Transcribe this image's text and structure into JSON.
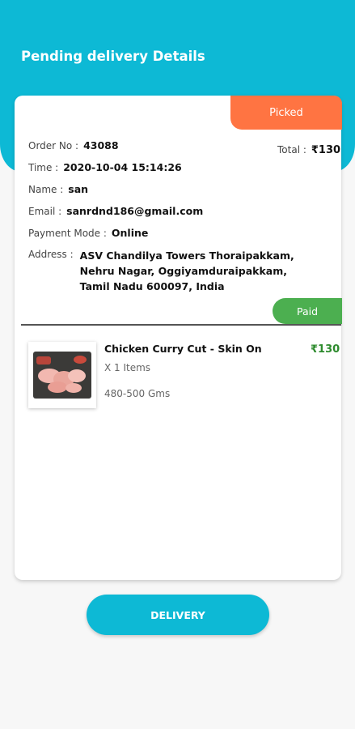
{
  "header": {
    "title": "Pending delivery Details"
  },
  "order": {
    "status": "Picked",
    "order_no_label": "Order No :",
    "order_no": "43088",
    "total_label": "Total :",
    "total": "₹130",
    "time_label": "Time :",
    "time": "2020-10-04 15:14:26",
    "name_label": "Name :",
    "name": "san",
    "email_label": "Email :",
    "email": "sanrdnd186@gmail.com",
    "payment_label": "Payment Mode :",
    "payment": "Online",
    "address_label": "Address :",
    "address": "ASV Chandilya Towers Thoraipakkam, Nehru Nagar, Oggiyamduraipakkam, Tamil Nadu 600097, India",
    "payment_status": "Paid"
  },
  "items": [
    {
      "name": "Chicken Curry Cut - Skin On",
      "quantity": "X 1 Items",
      "weight": "480-500 Gms",
      "price": "₹130"
    }
  ],
  "actions": {
    "delivery_label": "DELIVERY"
  },
  "colors": {
    "primary": "#0db9d5",
    "status_picked": "#ff7442",
    "status_paid": "#4caf50",
    "price": "#2e8b2e"
  }
}
